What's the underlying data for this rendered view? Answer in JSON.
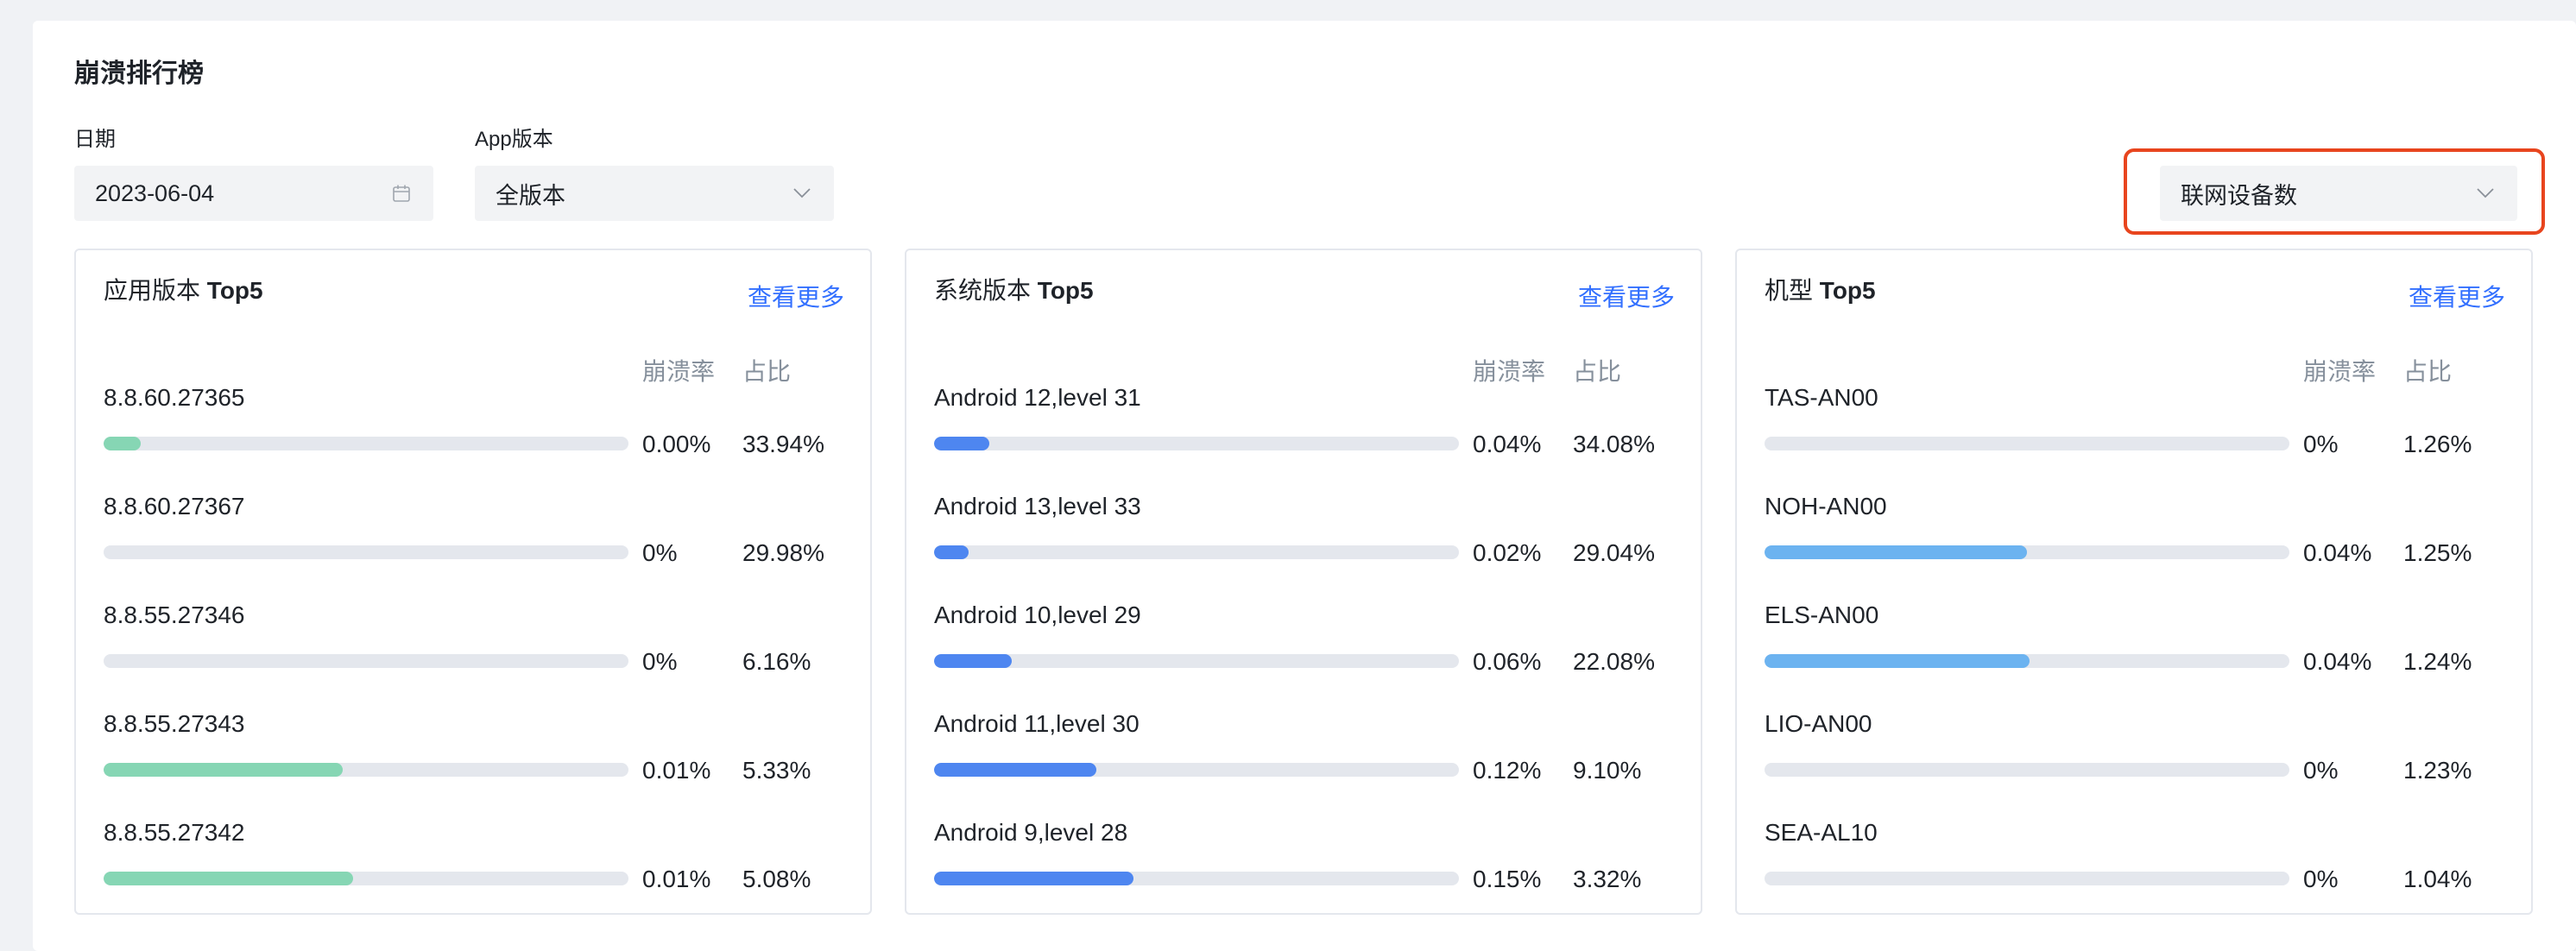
{
  "page_title": "崩溃排行榜",
  "filters": {
    "date": {
      "label": "日期",
      "value": "2023-06-04"
    },
    "app_version": {
      "label": "App版本",
      "value": "全版本"
    },
    "metric": {
      "value": "联网设备数"
    }
  },
  "colors": {
    "accent": "#3370ff",
    "highlight": "#e8451e",
    "bar_green": "#86d6b4",
    "bar_blue": "#4e86f0",
    "bar_lightblue": "#6cb3f0",
    "track": "#e4e7ed"
  },
  "cards": [
    {
      "title_prefix": "应用版本",
      "title_bold": "Top5",
      "more": "查看更多",
      "col_rate": "崩溃率",
      "col_share": "占比",
      "bar_color": "#86d6b4",
      "rows": [
        {
          "name": "8.8.60.27365",
          "rate": "0.00%",
          "share": "33.94%",
          "fill": 0.07
        },
        {
          "name": "8.8.60.27367",
          "rate": "0%",
          "share": "29.98%",
          "fill": 0
        },
        {
          "name": "8.8.55.27346",
          "rate": "0%",
          "share": "6.16%",
          "fill": 0
        },
        {
          "name": "8.8.55.27343",
          "rate": "0.01%",
          "share": "5.33%",
          "fill": 0.455
        },
        {
          "name": "8.8.55.27342",
          "rate": "0.01%",
          "share": "5.08%",
          "fill": 0.475
        }
      ]
    },
    {
      "title_prefix": "系统版本",
      "title_bold": "Top5",
      "more": "查看更多",
      "col_rate": "崩溃率",
      "col_share": "占比",
      "bar_color": "#4e86f0",
      "rows": [
        {
          "name": "Android 12,level 31",
          "rate": "0.04%",
          "share": "34.08%",
          "fill": 0.105
        },
        {
          "name": "Android 13,level 33",
          "rate": "0.02%",
          "share": "29.04%",
          "fill": 0.065
        },
        {
          "name": "Android 10,level 29",
          "rate": "0.06%",
          "share": "22.08%",
          "fill": 0.148
        },
        {
          "name": "Android 11,level 30",
          "rate": "0.12%",
          "share": "9.10%",
          "fill": 0.31
        },
        {
          "name": "Android 9,level 28",
          "rate": "0.15%",
          "share": "3.32%",
          "fill": 0.38
        }
      ]
    },
    {
      "title_prefix": "机型",
      "title_bold": "Top5",
      "more": "查看更多",
      "col_rate": "崩溃率",
      "col_share": "占比",
      "bar_color": "#6cb3f0",
      "rows": [
        {
          "name": "TAS-AN00",
          "rate": "0%",
          "share": "1.26%",
          "fill": 0
        },
        {
          "name": "NOH-AN00",
          "rate": "0.04%",
          "share": "1.25%",
          "fill": 0.5
        },
        {
          "name": "ELS-AN00",
          "rate": "0.04%",
          "share": "1.24%",
          "fill": 0.505
        },
        {
          "name": "LIO-AN00",
          "rate": "0%",
          "share": "1.23%",
          "fill": 0
        },
        {
          "name": "SEA-AL10",
          "rate": "0%",
          "share": "1.04%",
          "fill": 0
        }
      ]
    }
  ]
}
